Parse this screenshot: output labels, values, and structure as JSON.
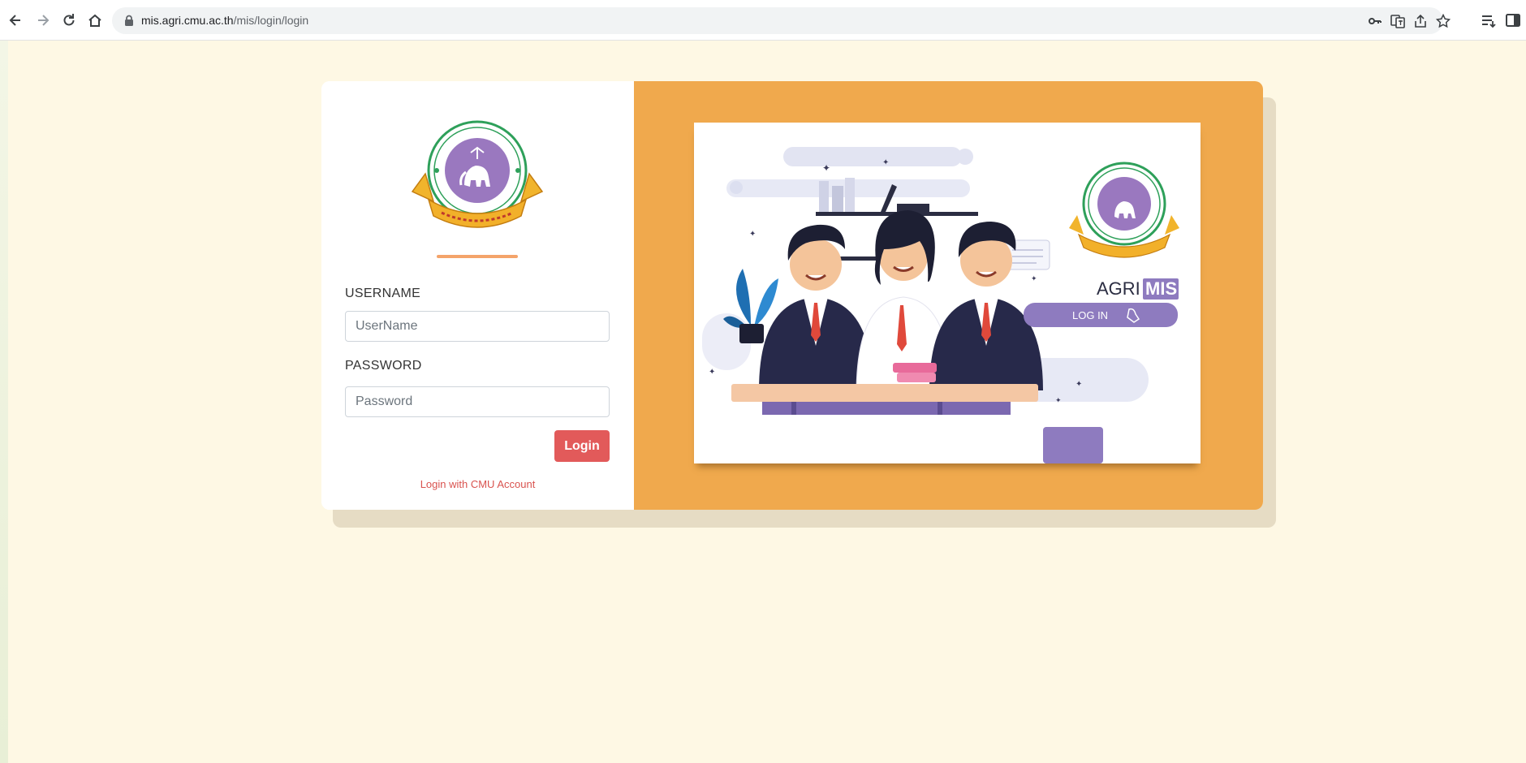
{
  "browser": {
    "url_host": "mis.agri.cmu.ac.th",
    "url_path": "/mis/login/login"
  },
  "login_form": {
    "username_label": "USERNAME",
    "username_placeholder": "UserName",
    "password_label": "PASSWORD",
    "password_placeholder": "Password",
    "login_button": "Login",
    "cmu_link": "Login with CMU Account"
  },
  "illustration": {
    "brand_left": "AGRI",
    "brand_right": "MIS",
    "button_text": "LOG IN"
  },
  "colors": {
    "page_bg": "#fef8e4",
    "panel_orange": "#f0a94d",
    "login_button": "#e25a5a",
    "accent_line": "#f4a46a",
    "brand_purple": "#8e7bbf"
  }
}
